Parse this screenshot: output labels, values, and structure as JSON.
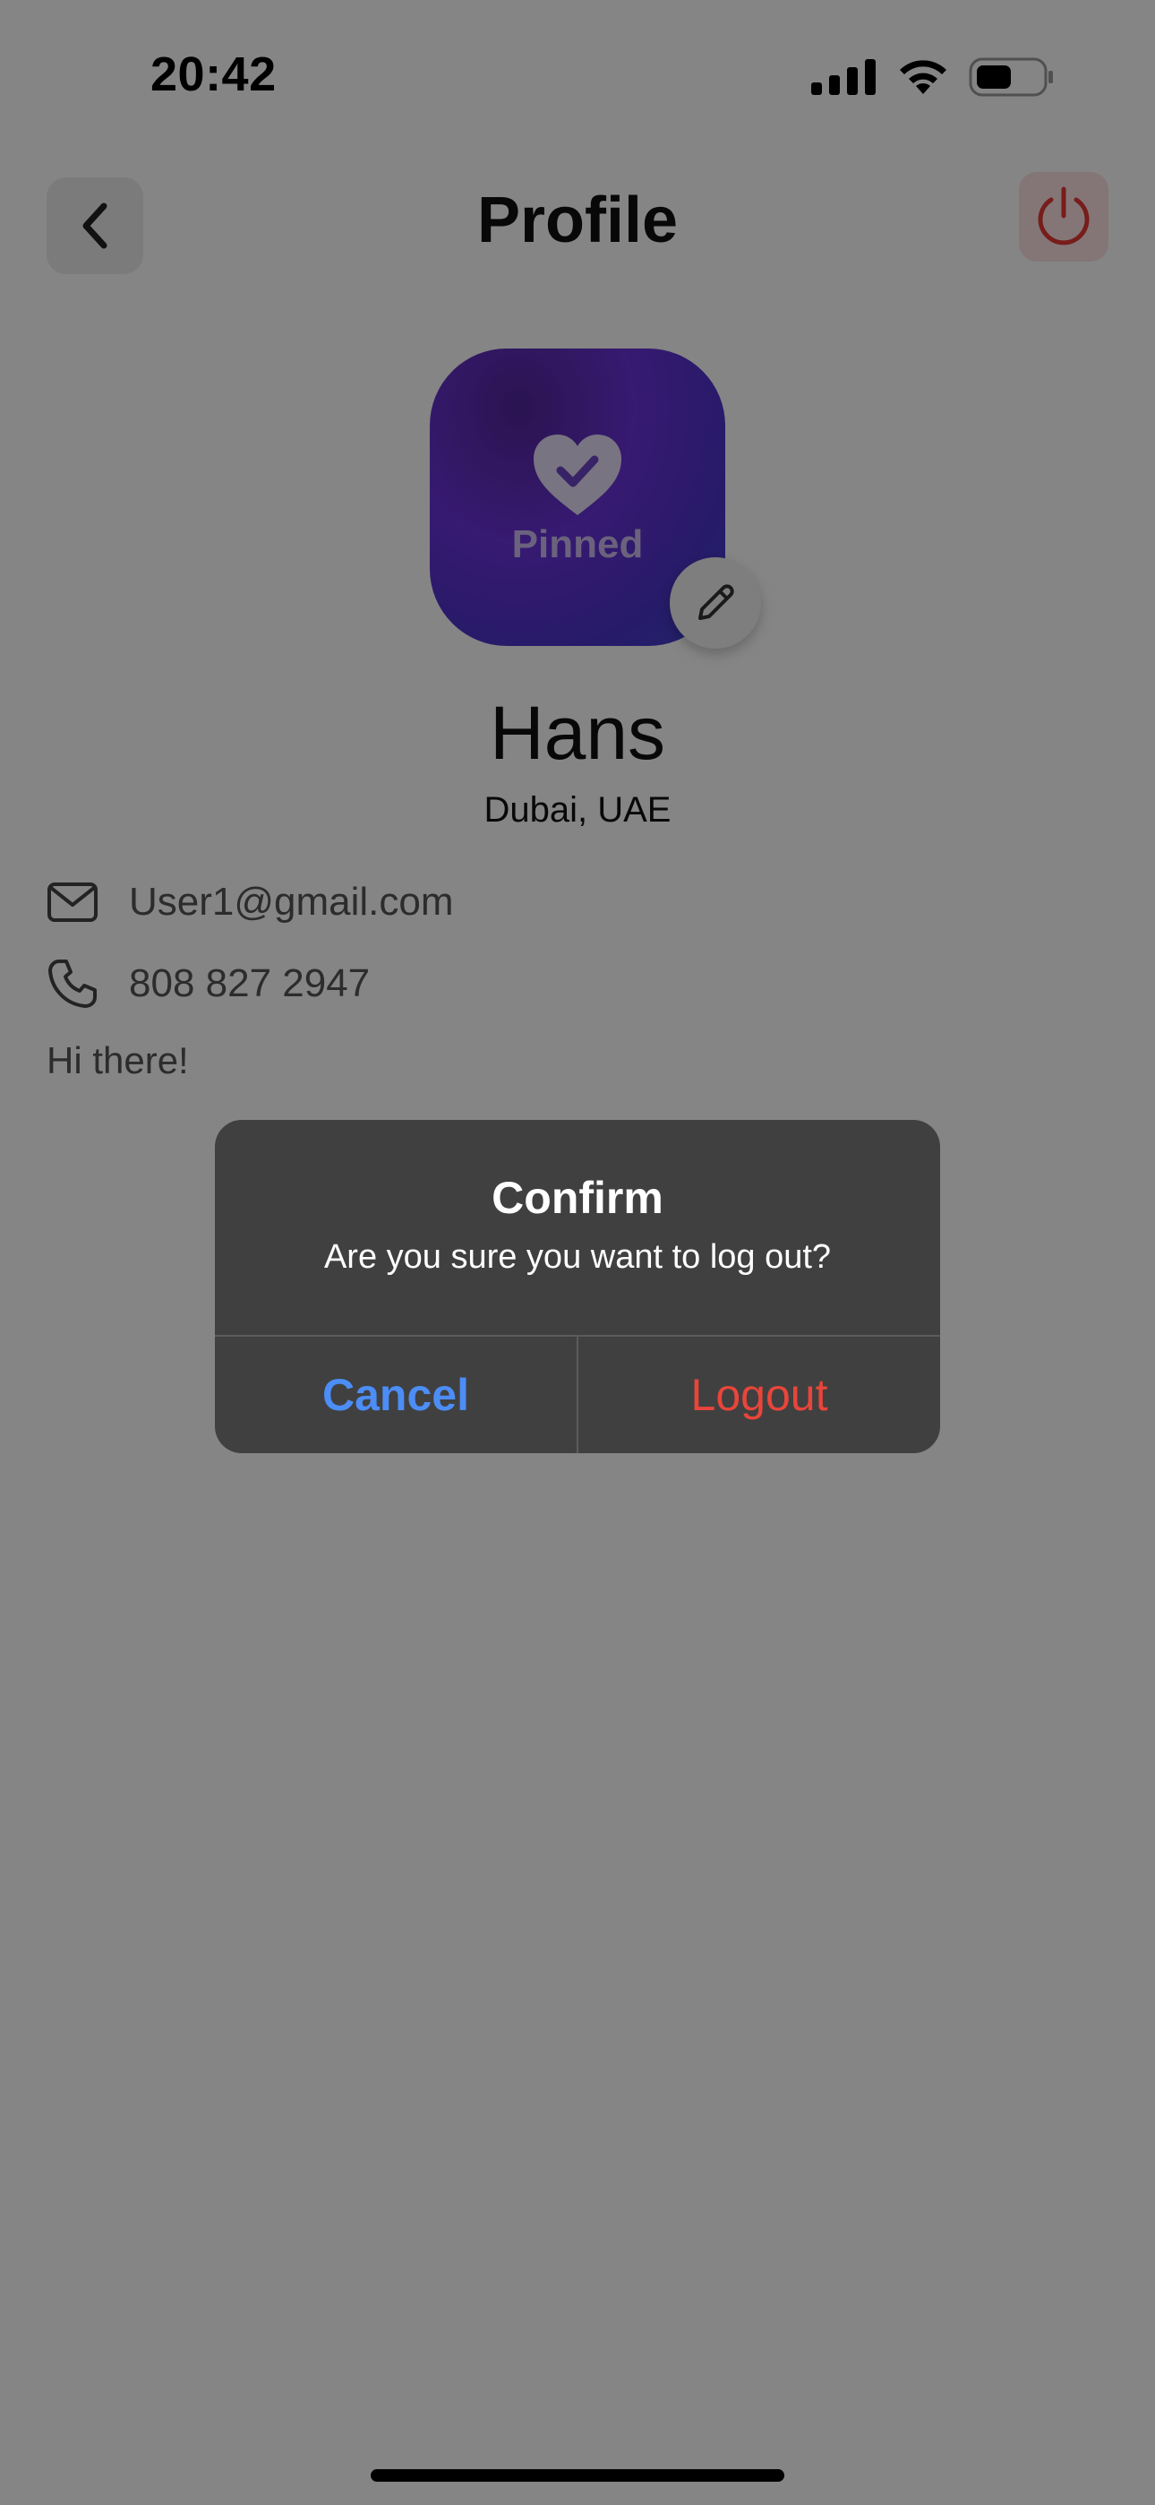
{
  "status_bar": {
    "time": "20:42"
  },
  "header": {
    "title": "Profile"
  },
  "avatar": {
    "label": "Pinned"
  },
  "profile": {
    "name": "Hans",
    "location": "Dubai, UAE",
    "email": "User1@gmail.com",
    "phone": "808 827 2947",
    "bio": "Hi there!"
  },
  "alert": {
    "title": "Confirm",
    "message": "Are you sure you want to log out?",
    "cancel_label": "Cancel",
    "logout_label": "Logout"
  },
  "colors": {
    "cancel_accent": "#4c8df6",
    "logout_accent": "#e9453a",
    "avatar_gradient_start": "#52279a",
    "avatar_gradient_end": "#3f46cf"
  }
}
